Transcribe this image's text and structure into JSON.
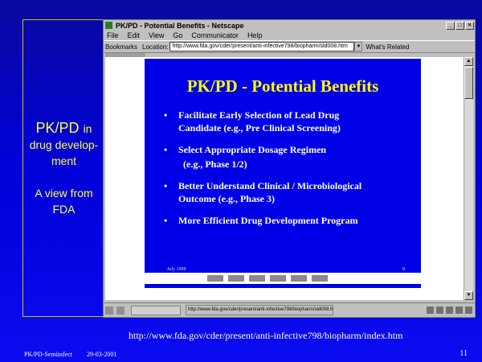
{
  "left_panel": {
    "pkpd": "PK/PD",
    "in": "in",
    "line2a": "drug develop-",
    "line2b": "ment",
    "line3a": "A view from",
    "line3b": "FDA"
  },
  "browser": {
    "title": "PK/PD - Potential Benefits - Netscape",
    "menu": [
      "File",
      "Edit",
      "View",
      "Go",
      "Communicator",
      "Help"
    ],
    "bookmarks_label": "Bookmarks",
    "location_label": "Location:",
    "location_value": "http://www.fda.gov/cder/present/anti-infective798/biopharm/sld008.htm",
    "related_label": "What's Related",
    "status_url": "http://www.fda.gov/cder/present/anti-infective798/biopharm/sld008.htm"
  },
  "slide": {
    "title": "PK/PD - Potential Benefits",
    "bullets": [
      {
        "l1": "Facilitate Early Selection of Lead Drug",
        "l2": "Candidate (e.g., Pre Clinical Screening)"
      },
      {
        "l1": "Select Appropriate Dosage Regimen",
        "l2": "(e.g., Phase 1/2)"
      },
      {
        "l1": "Better Understand Clinical / Microbiological",
        "l2": "Outcome (e.g., Phase 3)"
      },
      {
        "l1": "More Efficient Drug Development Program",
        "l2": ""
      }
    ],
    "date": "July 1998",
    "page": "8"
  },
  "footer": {
    "url": "http://www.fda.gov/cder/present/anti-infective798/biopharm/index.htm",
    "left": "PK/PD-Semiinfect",
    "date": "29-03-2001",
    "page": "11"
  }
}
